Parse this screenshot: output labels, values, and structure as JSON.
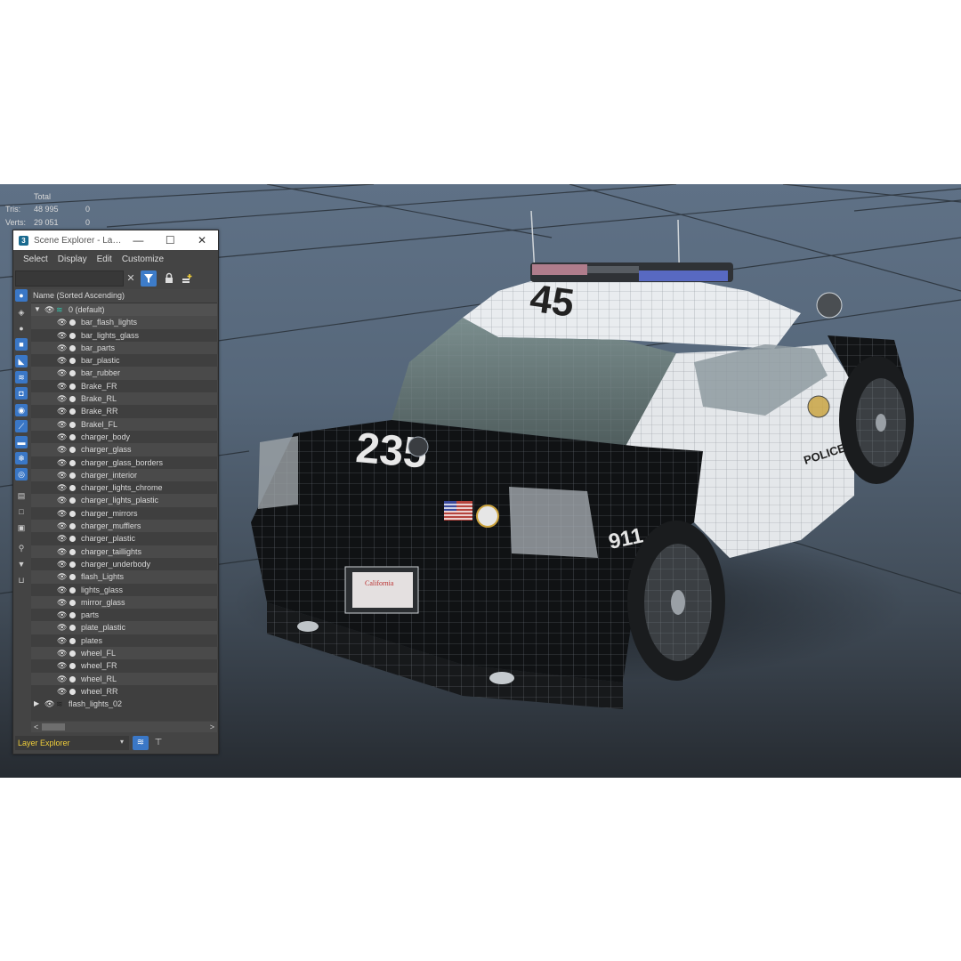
{
  "stats": {
    "header": "Total",
    "rows": [
      {
        "label": "Tris:",
        "value": "48 995",
        "selected": "0"
      },
      {
        "label": "Verts:",
        "value": "29 051",
        "selected": "0"
      }
    ]
  },
  "window": {
    "app_icon": "3",
    "title": "Scene Explorer - Laye...",
    "minimize": "—",
    "maximize": "☐",
    "close": "✕"
  },
  "menu": [
    "Select",
    "Display",
    "Edit",
    "Customize"
  ],
  "toolbar": {
    "search_value": "",
    "clear_icon": "✕",
    "filter_icon": "filter-icon",
    "lock_icon": "lock-icon",
    "add_layer_icon": "add-layer-icon"
  },
  "list": {
    "column_header": "Name (Sorted Ascending)",
    "root_layer": "0 (default)",
    "items": [
      "bar_flash_lights",
      "bar_lights_glass",
      "bar_parts",
      "bar_plastic",
      "bar_rubber",
      "Brake_FR",
      "Brake_RL",
      "Brake_RR",
      "Brakel_FL",
      "charger_body",
      "charger_glass",
      "charger_glass_borders",
      "charger_interior",
      "charger_lights_chrome",
      "charger_lights_plastic",
      "charger_mirrors",
      "charger_mufflers",
      "charger_plastic",
      "charger_taillights",
      "charger_underbody",
      "flash_Lights",
      "lights_glass",
      "mirror_glass",
      "parts",
      "plate_plastic",
      "plates",
      "wheel_FL",
      "wheel_FR",
      "wheel_RL",
      "wheel_RR"
    ],
    "second_layer": "flash_lights_02"
  },
  "status": {
    "explorer_combo": "Layer Explorer"
  },
  "car": {
    "roof_number": "45",
    "trunk_number": "235",
    "side_text": "POLICE",
    "side_number": "911",
    "plate_text": "California"
  },
  "colors": {
    "accent_blue": "#3a77c6",
    "layer_icon_teal": "#34c0a8",
    "combo_text": "#f1cf3a"
  }
}
